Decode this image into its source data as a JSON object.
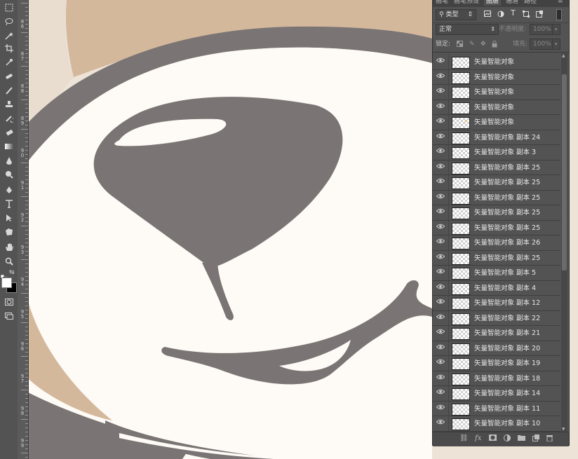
{
  "panel": {
    "tabs": [
      "画笔",
      "画笔预设",
      "图层",
      "通道",
      "路径"
    ],
    "active_tab": "图层",
    "filter_label": "类型",
    "filter_arrow": "⇕",
    "blend_mode": "正常",
    "opacity_label": "不透明度:",
    "opacity_value": "100%",
    "lock_label": "锁定:",
    "fill_label": "填充:",
    "fill_value": "100%",
    "layers": [
      {
        "name": "矢量智能对象"
      },
      {
        "name": "矢量智能对象"
      },
      {
        "name": "矢量智能对象"
      },
      {
        "name": "矢量智能对象"
      },
      {
        "name": "矢量智能对象"
      },
      {
        "name": "矢量智能对象 副本 24"
      },
      {
        "name": "矢量智能对象 副本 3"
      },
      {
        "name": "矢量智能对象 副本 25"
      },
      {
        "name": "矢量智能对象 副本 25"
      },
      {
        "name": "矢量智能对象 副本 25"
      },
      {
        "name": "矢量智能对象 副本 25"
      },
      {
        "name": "矢量智能对象 副本 25"
      },
      {
        "name": "矢量智能对象 副本 26"
      },
      {
        "name": "矢量智能对象 副本 25"
      },
      {
        "name": "矢量智能对象 副本 5"
      },
      {
        "name": "矢量智能对象 副本 4"
      },
      {
        "name": "矢量智能对象 副本 12"
      },
      {
        "name": "矢量智能对象 副本 22"
      },
      {
        "name": "矢量智能对象 副本 21"
      },
      {
        "name": "矢量智能对象 副本 20"
      },
      {
        "name": "矢量智能对象 副本 19"
      },
      {
        "name": "矢量智能对象 副本 18"
      },
      {
        "name": "矢量智能对象 副本 14"
      },
      {
        "name": "矢量智能对象 副本 11"
      },
      {
        "name": "矢量智能对象 副本 10"
      }
    ]
  },
  "ruler": {
    "labels": [
      "8\n6",
      "8\n7",
      "8\n8",
      "8\n9",
      "9\n0",
      "9\n1",
      "9\n2",
      "9\n3",
      "9\n4",
      "9\n5",
      "9\n6",
      "9\n7",
      "9\n8",
      "9\n9"
    ]
  },
  "icons": {
    "eye": "eye-icon",
    "link": "link-icon",
    "fx": "fx-icon",
    "mask": "mask-icon",
    "adjustment": "adjustment-icon",
    "folder": "folder-icon",
    "new_layer": "new-layer-icon",
    "trash": "trash-icon"
  },
  "colors": {
    "canvas_bg": "#ede3d6",
    "tan": "#d4b89c",
    "face_white": "#fefaf5",
    "gray_art": "#7a7574",
    "panel_bg": "#535353",
    "toolbar_bg": "#535353"
  }
}
